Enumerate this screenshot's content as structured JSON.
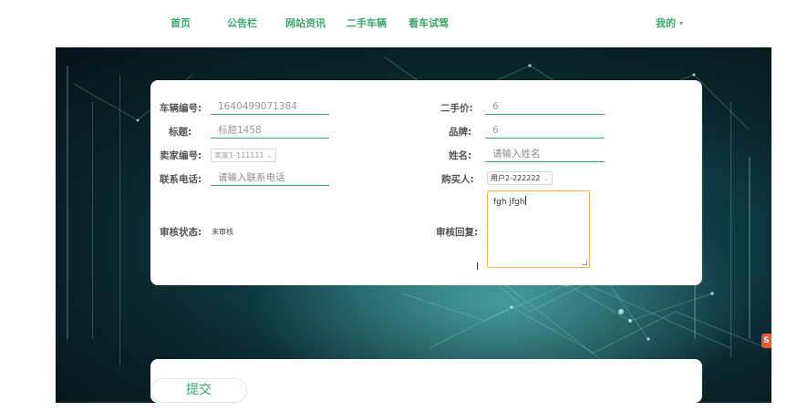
{
  "nav": {
    "items": [
      "首页",
      "公告栏",
      "网站资讯",
      "二手车辆",
      "看车试驾"
    ],
    "user": "我的"
  },
  "form": {
    "vehicle_no_label": "车辆编号:",
    "vehicle_no_value": "1640499071384",
    "title_label": "标题:",
    "title_value": "标题1458",
    "seller_label": "卖家编号:",
    "seller_value": "卖家1-111111",
    "phone_label": "联系电话:",
    "phone_placeholder": "请输入联系电话",
    "status_label": "审核状态:",
    "status_value": "未审核",
    "price_label": "二手价:",
    "price_value": "6",
    "brand_label": "品牌:",
    "brand_value": "6",
    "name_label": "姓名:",
    "name_placeholder": "请输入姓名",
    "buyer_label": "购买人:",
    "buyer_value": "用户2-222222",
    "reply_label": "审核回复:",
    "reply_value": "fgh jfgh"
  },
  "submit_label": "提交",
  "colors": {
    "accent": "#3aa86a",
    "focus": "#f0b54a"
  }
}
